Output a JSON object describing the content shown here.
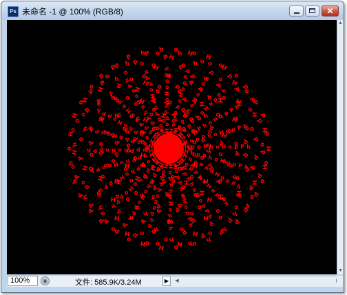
{
  "window": {
    "app_icon_text": "Ps",
    "title": "未命名 -1 @ 100% (RGB/8)",
    "minimize_label": "",
    "maximize_label": "",
    "close_label": "✕"
  },
  "canvas": {
    "background_color": "#000000",
    "artwork_color": "#ff0000",
    "artwork_text": "HopPho"
  },
  "statusbar": {
    "zoom": "100%",
    "doc_info": "文件: 585.9K/3.24M",
    "menu_arrow": "▶"
  },
  "icons": {
    "nav": "circle-arrow-icon",
    "scroll_up": "▲",
    "scroll_down": "▼",
    "scroll_left": "◀",
    "scroll_right": "▶"
  }
}
